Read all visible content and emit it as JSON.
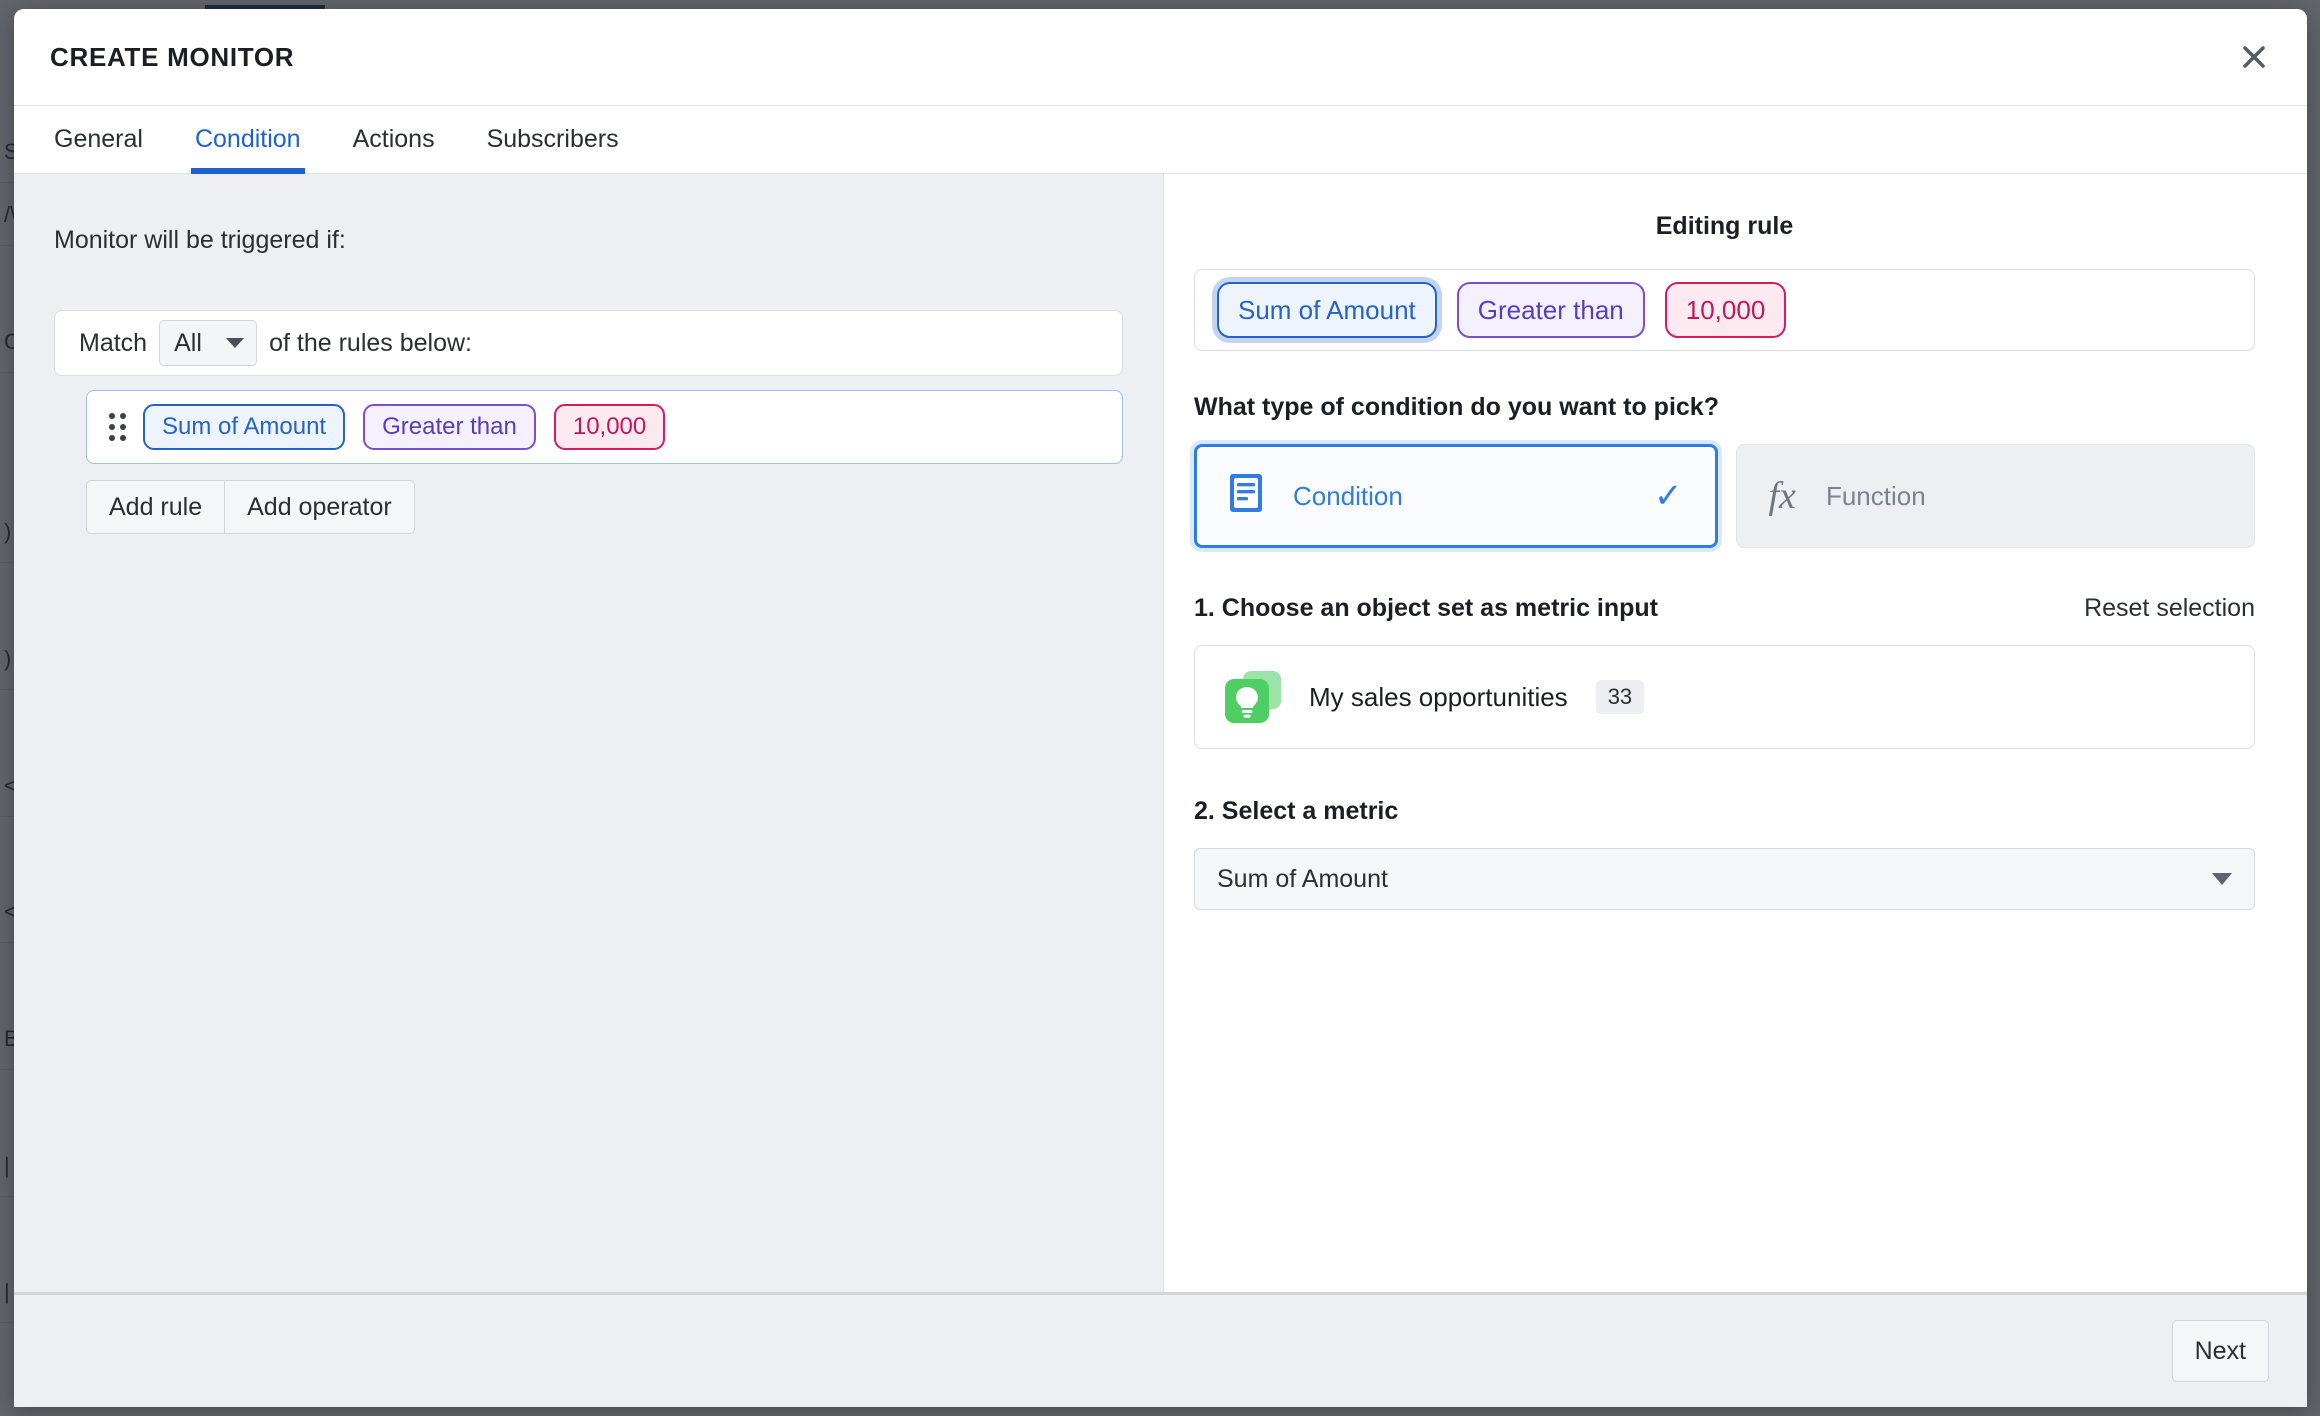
{
  "background": {
    "rows": [
      "S",
      "/\\",
      "C",
      ")",
      ")",
      "<",
      "<",
      "B",
      "|",
      "|",
      "]",
      "]"
    ]
  },
  "modal": {
    "title": "CREATE MONITOR",
    "close_icon": "close-icon",
    "tabs": [
      {
        "label": "General",
        "active": false
      },
      {
        "label": "Condition",
        "active": true
      },
      {
        "label": "Actions",
        "active": false
      },
      {
        "label": "Subscribers",
        "active": false
      }
    ],
    "footer": {
      "next_label": "Next"
    }
  },
  "left_pane": {
    "trigger_label": "Monitor will be triggered if:",
    "match": {
      "prefix": "Match",
      "value": "All",
      "suffix": "of the rules below:"
    },
    "rule": {
      "metric": "Sum of Amount",
      "operator": "Greater than",
      "value": "10,000"
    },
    "buttons": {
      "add_rule": "Add rule",
      "add_operator": "Add operator"
    }
  },
  "right_pane": {
    "title": "Editing rule",
    "editing_rule": {
      "metric": "Sum of Amount",
      "operator": "Greater than",
      "value": "10,000"
    },
    "condition_type": {
      "heading": "What type of condition do you want to pick?",
      "options": [
        {
          "label": "Condition",
          "icon": "document-lines-icon",
          "selected": true,
          "check": "✓"
        },
        {
          "label": "Function",
          "icon": "fx-icon",
          "selected": false
        }
      ]
    },
    "object_set": {
      "heading": "1. Choose an object set as metric input",
      "reset_label": "Reset selection",
      "icon": "lightbulb-icon",
      "name": "My sales opportunities",
      "count": "33"
    },
    "metric": {
      "heading": "2. Select a metric",
      "selected": "Sum of Amount"
    }
  },
  "colors": {
    "accent_blue": "#2563c9",
    "tab_blue": "#1d62cf",
    "operator_purple": "#5a3dbb",
    "value_pink": "#c2185b",
    "object_green": "#4fce63",
    "panel_grey": "#eeeff2"
  }
}
